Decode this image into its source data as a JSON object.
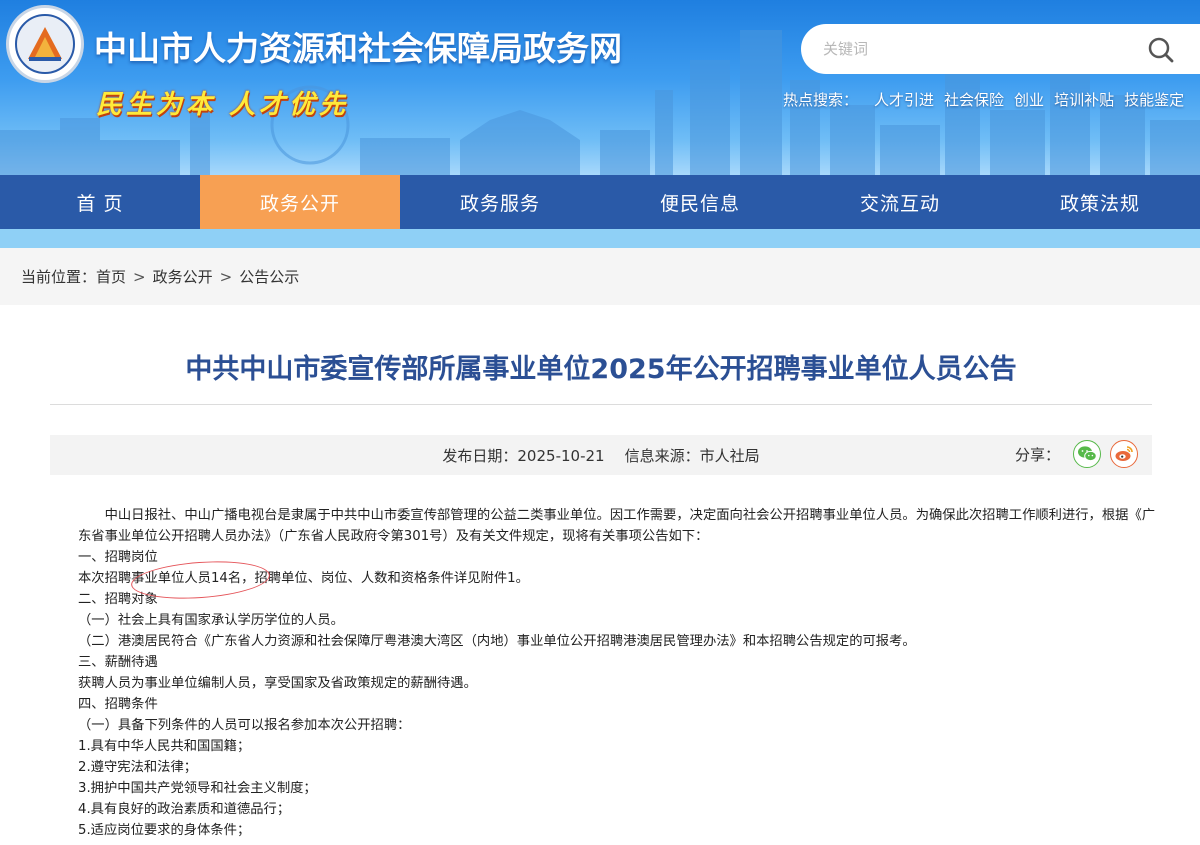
{
  "header": {
    "site_title": "中山市人力资源和社会保障局政务网",
    "slogan": "民生为本 人才优先",
    "search": {
      "placeholder": "关键词"
    },
    "hot_search": {
      "label": "热点搜索：",
      "items": [
        "人才引进",
        "社会保险",
        "创业",
        "培训补贴",
        "技能鉴定"
      ]
    }
  },
  "nav": {
    "items": [
      "首 页",
      "政务公开",
      "政务服务",
      "便民信息",
      "交流互动",
      "政策法规"
    ],
    "active_index": 1,
    "active_color": "#f7a053",
    "bar_color": "#2a5aa8"
  },
  "breadcrumb": {
    "label": "当前位置：",
    "items": [
      "首页",
      "政务公开",
      "公告公示"
    ],
    "separator": ">"
  },
  "article": {
    "title": "中共中山市委宣传部所属事业单位2025年公开招聘事业单位人员公告",
    "publish_date": "发布日期：2025-10-21",
    "source": "信息来源：市人社局",
    "share_label": "分享：",
    "paragraphs": [
      "中山日报社、中山广播电视台是隶属于中共中山市委宣传部管理的公益二类事业单位。因工作需要，决定面向社会公开招聘事业单位人员。为确保此次招聘工作顺利进行，根据《广东省事业单位公开招聘人员办法》（广东省人民政府令第301号）及有关文件规定，现将有关事项公告如下：",
      "一、招聘岗位",
      "本次招聘事业单位人员14名，招聘单位、岗位、人数和资格条件详见附件1。",
      "二、招聘对象",
      "（一）社会上具有国家承认学历学位的人员。",
      "（二）港澳居民符合《广东省人力资源和社会保障厅粤港澳大湾区（内地）事业单位公开招聘港澳居民管理办法》和本招聘公告规定的可报考。",
      "三、薪酬待遇",
      "获聘人员为事业单位编制人员，享受国家及省政策规定的薪酬待遇。",
      "四、招聘条件",
      "（一）具备下列条件的人员可以报名参加本次公开招聘：",
      "1.具有中华人民共和国国籍；",
      "2.遵守宪法和法律；",
      "3.拥护中国共产党领导和社会主义制度；",
      "4.具有良好的政治素质和道德品行；",
      "5.适应岗位要求的身体条件；"
    ]
  }
}
